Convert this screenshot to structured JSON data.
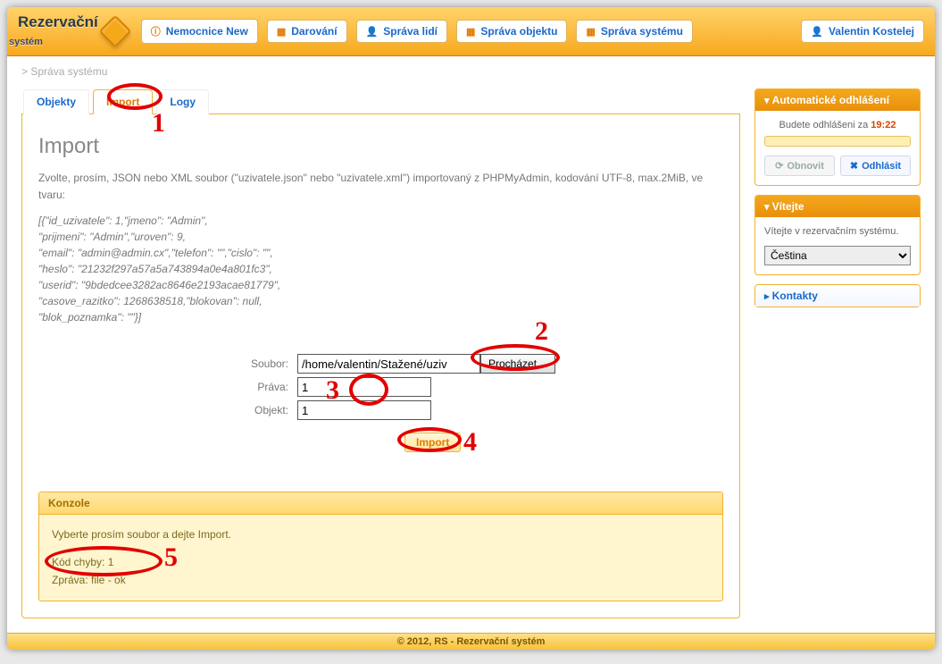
{
  "logo": {
    "line1": "Rezervační",
    "line2": "systém"
  },
  "nav": [
    {
      "label": "Nemocnice New"
    },
    {
      "label": "Darování"
    },
    {
      "label": "Správa lidí"
    },
    {
      "label": "Správa objektu"
    },
    {
      "label": "Správa systému"
    }
  ],
  "user": "Valentin Kostelej",
  "breadcrumb": "> Správa systému",
  "tabs": {
    "objekty": "Objekty",
    "import": "Import",
    "logy": "Logy"
  },
  "page_title": "Import",
  "instructions": "Zvolte, prosím, JSON nebo XML soubor (\"uzivatele.json\" nebo \"uzivatele.xml\") importovaný z PHPMyAdmin, kodování UTF-8, max.2MiB, ve tvaru:",
  "json_lines": [
    "[{\"id_uzivatele\": 1,\"jmeno\": \"Admin\",",
    "\"prijmeni\": \"Admin\",\"uroven\": 9,",
    "\"email\": \"admin@admin.cx\",\"telefon\": \"\",\"cislo\": \"\",",
    "\"heslo\": \"21232f297a57a5a743894a0e4a801fc3\",",
    "\"userid\": \"9bdedcee3282ac8646e2193acae81779\",",
    "\"casove_razitko\": 1268638518,\"blokovan\": null,",
    "\"blok_poznamka\": \"\"}]"
  ],
  "form": {
    "soubor_label": "Soubor:",
    "soubor_value": "/home/valentin/Stažené/uziv",
    "browse": "Procházet…",
    "prava_label": "Práva:",
    "prava_value": "1",
    "objekt_label": "Objekt:",
    "objekt_value": "1",
    "import_btn": "Import"
  },
  "konzole": {
    "title": "Konzole",
    "line1": "Vyberte prosím soubor a dejte Import.",
    "line2": "Kód chyby: 1",
    "line3": "Zpráva: file - ok"
  },
  "logout_panel": {
    "title": "Automatické odhlášení",
    "text_prefix": "Budete odhlášeni za ",
    "time": "19:22",
    "obnovit": "Obnovit",
    "odhlasit": "Odhlásit"
  },
  "welcome_panel": {
    "title": "Vítejte",
    "text": "Vítejte v rezervačním systému.",
    "lang": "Čeština"
  },
  "kontakty_title": "Kontakty",
  "footer": "© 2012, RS - Rezervační systém",
  "annotations": {
    "n1": "1",
    "n2": "2",
    "n3": "3",
    "n4": "4",
    "n5": "5"
  }
}
